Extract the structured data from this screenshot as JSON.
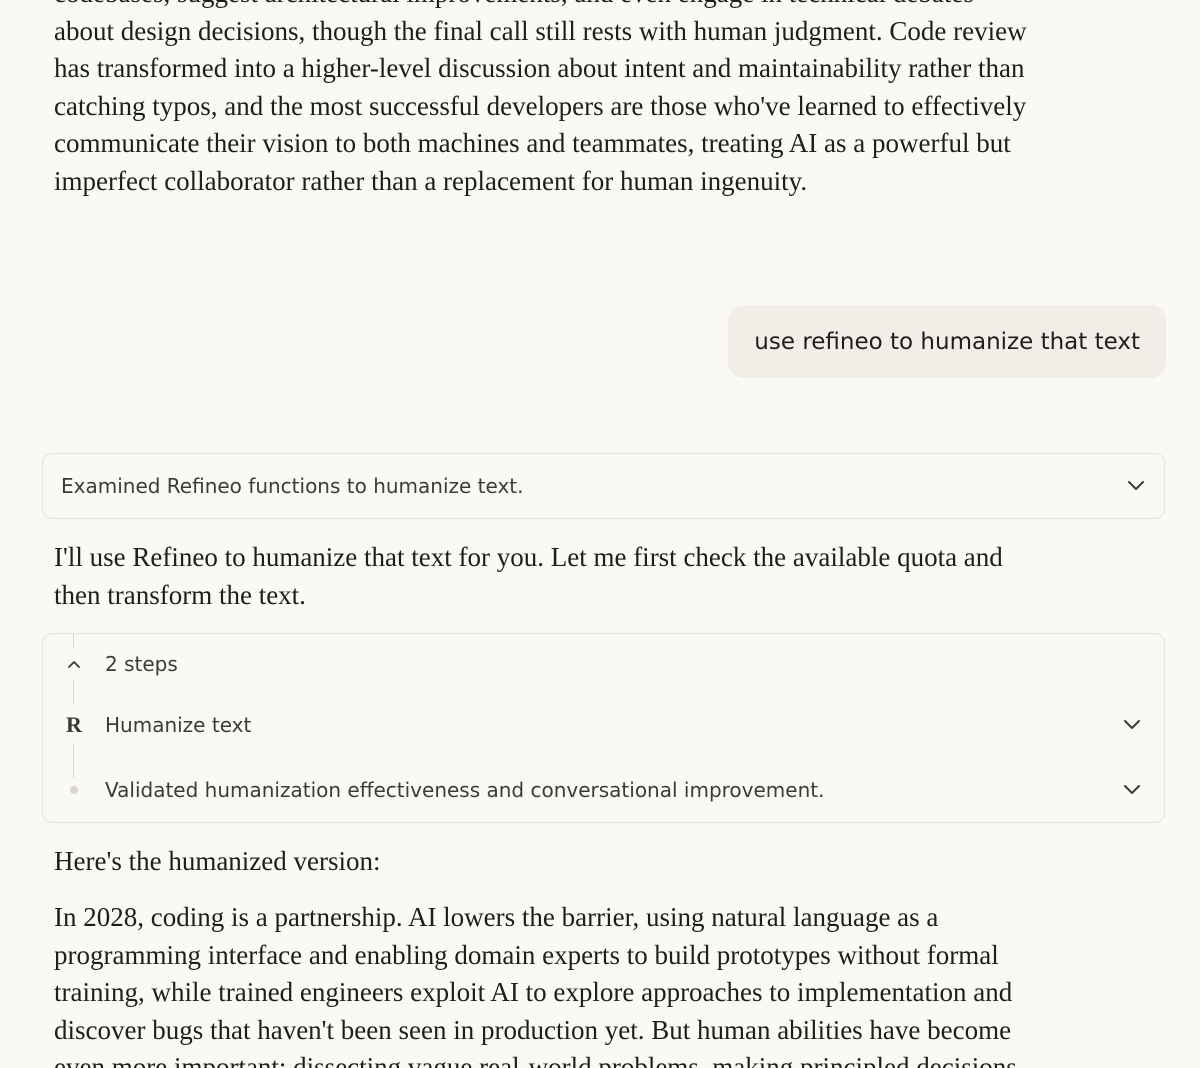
{
  "top_paragraph": {
    "lines": [
      "codebases, suggest architectural improvements, and even engage in technical debates",
      "about design decisions, though the final call still rests with human judgment. Code review",
      "has transformed into a higher-level discussion about intent and maintainability rather than",
      "catching typos, and the most successful developers are those who've learned to effectively",
      "communicate their vision to both machines and teammates, treating AI as a powerful but",
      "imperfect collaborator rather than a replacement for human ingenuity."
    ]
  },
  "user_message": {
    "text": "use refineo to humanize that text"
  },
  "thinking": {
    "label": "Examined Refineo functions to humanize text."
  },
  "assistant_intro": {
    "lines": [
      "I'll use Refineo to humanize that text for you. Let me first check the available quota and",
      "then transform the text."
    ]
  },
  "steps_panel": {
    "summary": "2 steps",
    "steps": [
      {
        "icon": "refineo-logo-icon",
        "logo_text": "R",
        "label": "Humanize text"
      },
      {
        "icon": "dot-icon",
        "label": "Validated humanization effectiveness and conversational improvement."
      }
    ]
  },
  "result_heading": "Here's the humanized version:",
  "result_paragraph": {
    "lines": [
      "In 2028, coding is a partnership. AI lowers the barrier, using natural language as a",
      "programming interface and enabling domain experts to build prototypes without formal",
      "training, while trained engineers exploit AI to explore approaches to implementation and",
      "discover bugs that haven't been seen in production yet. But human abilities have become",
      "even more important: dissecting vague real-world problems, making principled decisions"
    ]
  }
}
